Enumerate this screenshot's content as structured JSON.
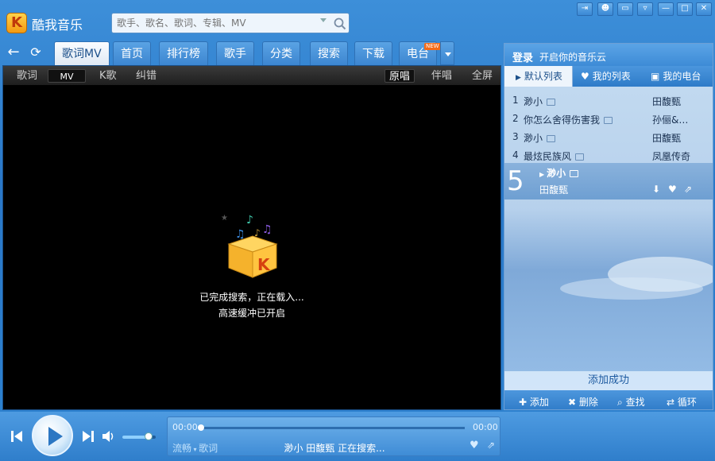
{
  "app": {
    "title": "酷我音乐",
    "logo_letter": "K"
  },
  "search": {
    "placeholder": "歌手、歌名、歌词、专辑、MV"
  },
  "window_controls": [
    "⇥",
    "☻",
    "▭",
    "▿",
    "—",
    "□",
    "✕"
  ],
  "tabs": [
    {
      "label": "歌词MV",
      "active": true
    },
    {
      "label": "首页"
    },
    {
      "label": "排行榜"
    },
    {
      "label": "歌手"
    },
    {
      "label": "分类"
    },
    {
      "label": "搜索"
    },
    {
      "label": "下载"
    },
    {
      "label": "电台"
    }
  ],
  "new_badge": "NEW",
  "subbar": {
    "left": [
      "歌词",
      "MV",
      "K歌",
      "纠错"
    ],
    "right": [
      "原唱",
      "伴唱",
      "全屏"
    ],
    "active_left": "MV",
    "active_right": "原唱"
  },
  "video": {
    "message_1": "已完成搜索，正在载入...",
    "message_2": "高速缓冲已开启"
  },
  "right_panel": {
    "login_link": "登录",
    "login_sub": "开启你的音乐云",
    "tabs": [
      "默认列表",
      "我的列表",
      "我的电台"
    ],
    "songs": [
      {
        "num": "1",
        "title": "渺小",
        "artist": "田馥甄"
      },
      {
        "num": "2",
        "title": "你怎么舍得伤害我",
        "artist": "孙俪&…"
      },
      {
        "num": "3",
        "title": "渺小",
        "artist": "田馥甄"
      },
      {
        "num": "4",
        "title": "最炫民族风",
        "artist": "凤凰传奇"
      }
    ],
    "playing": {
      "num": "5",
      "title": "渺小",
      "artist": "田馥甄"
    },
    "status": "添加成功",
    "bottom": [
      "添加",
      "删除",
      "查找",
      "循环"
    ]
  },
  "player": {
    "time_current": "00:00",
    "time_total": "00:00",
    "quality": "流畅",
    "lyric_opt": "歌词",
    "now_playing": "渺小 田馥甄 正在搜索...",
    "volume": 0.78,
    "progress": 0.0
  },
  "colors": {
    "accent": "#2d82d0",
    "tab_active": "#1b4f8a",
    "video_bg": "#000000"
  }
}
